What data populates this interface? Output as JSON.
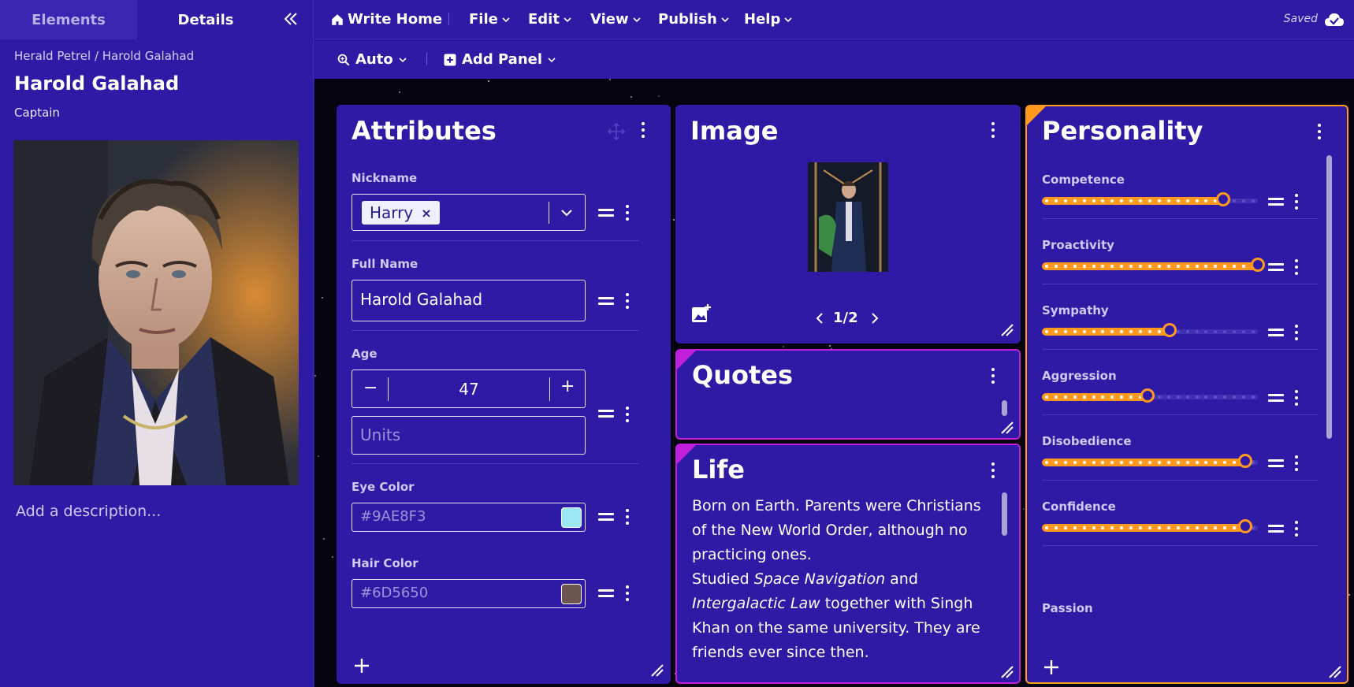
{
  "sidebar": {
    "tabs": [
      "Elements",
      "Details"
    ],
    "breadcrumb": "Herald Petrel / Harold Galahad",
    "name": "Harold Galahad",
    "role": "Captain",
    "add_description": "Add a description..."
  },
  "menubar": {
    "home": "Write Home",
    "items": [
      "File",
      "Edit",
      "View",
      "Publish",
      "Help"
    ],
    "status": "Saved"
  },
  "toolbar": {
    "zoom": "Auto",
    "add_panel": "Add Panel"
  },
  "attributes": {
    "title": "Attributes",
    "nickname_label": "Nickname",
    "nickname_tag": "Harry",
    "fullname_label": "Full Name",
    "fullname_value": "Harold Galahad",
    "age_label": "Age",
    "age_value": "47",
    "units_placeholder": "Units",
    "eye_label": "Eye Color",
    "eye_value": "#9AE8F3",
    "hair_label": "Hair Color",
    "hair_value": "#6D5650"
  },
  "image_panel": {
    "title": "Image",
    "pager": "1/2"
  },
  "quotes_panel": {
    "title": "Quotes"
  },
  "life_panel": {
    "title": "Life",
    "text_1": "Born on Earth. Parents were Christians of the New World Order, although no practicing ones.",
    "text_2a": "Studied ",
    "text_2b": "Space Navigation",
    "text_2c": " and ",
    "text_2d": "Intergalactic Law",
    "text_2e": " together with Singh Khan on the same university. They are friends ever since then."
  },
  "personality": {
    "title": "Personality",
    "traits": [
      {
        "label": "Competence",
        "value": 0.84
      },
      {
        "label": "Proactivity",
        "value": 1.0
      },
      {
        "label": "Sympathy",
        "value": 0.59
      },
      {
        "label": "Aggression",
        "value": 0.49
      },
      {
        "label": "Disobedience",
        "value": 0.94
      },
      {
        "label": "Confidence",
        "value": 0.94
      }
    ],
    "last_label": "Passion"
  },
  "colors": {
    "accent_orange": "#ff9a1f",
    "accent_magenta": "#c21fd9",
    "panel_bg": "#2e1aa5"
  }
}
